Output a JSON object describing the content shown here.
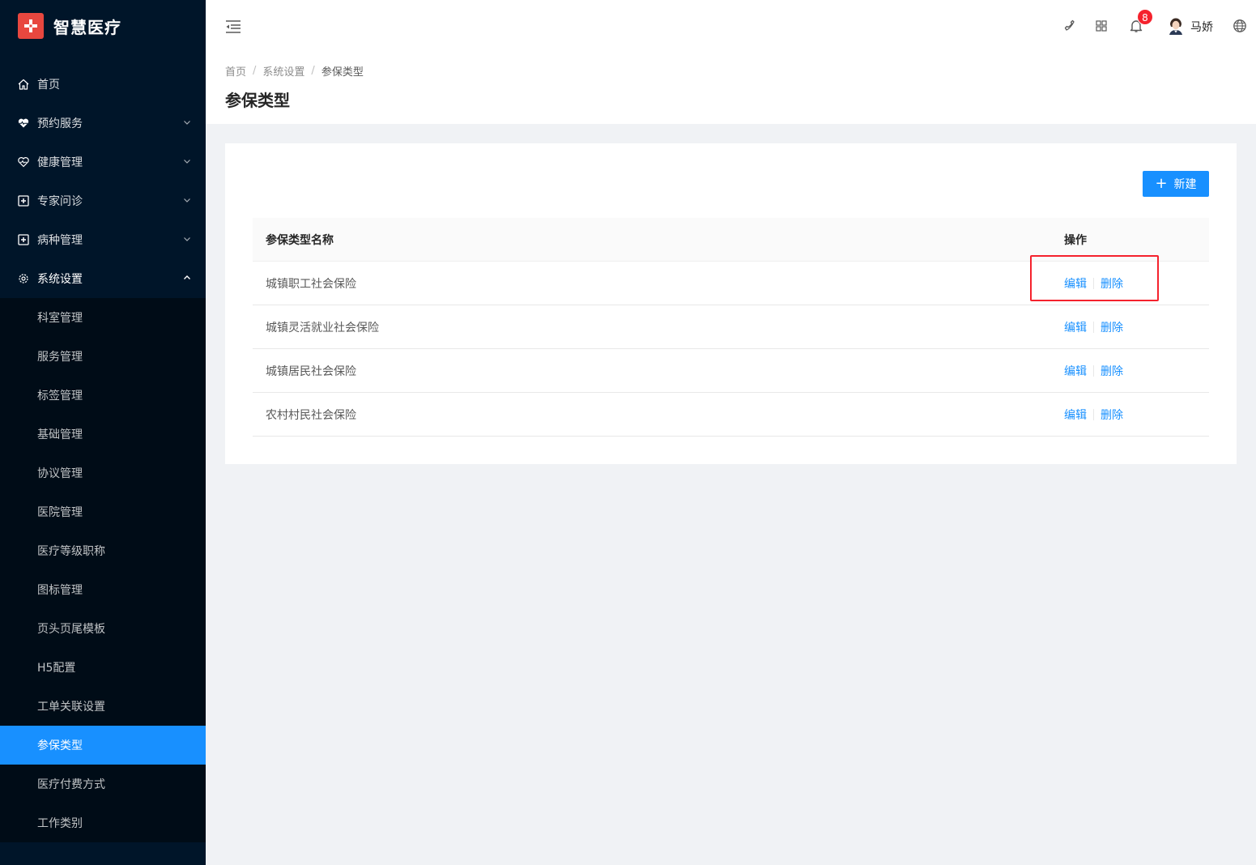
{
  "app": {
    "title": "智慧医疗"
  },
  "sidebar": {
    "items": [
      {
        "label": "首页",
        "icon": "home-icon"
      },
      {
        "label": "预约服务",
        "icon": "heart-pulse-icon"
      },
      {
        "label": "健康管理",
        "icon": "heart-outline-icon"
      },
      {
        "label": "专家问诊",
        "icon": "medical-box-icon"
      },
      {
        "label": "病种管理",
        "icon": "medical-box-icon"
      },
      {
        "label": "系统设置",
        "icon": "gear-icon"
      }
    ],
    "sub_items": [
      {
        "label": "科室管理"
      },
      {
        "label": "服务管理"
      },
      {
        "label": "标签管理"
      },
      {
        "label": "基础管理"
      },
      {
        "label": "协议管理"
      },
      {
        "label": "医院管理"
      },
      {
        "label": "医疗等级职称"
      },
      {
        "label": "图标管理"
      },
      {
        "label": "页头页尾模板"
      },
      {
        "label": "H5配置"
      },
      {
        "label": "工单关联设置"
      },
      {
        "label": "参保类型"
      },
      {
        "label": "医疗付费方式"
      },
      {
        "label": "工作类别"
      }
    ],
    "active_sub_item": "参保类型"
  },
  "header": {
    "notification_count": "8",
    "username": "马娇"
  },
  "breadcrumb": {
    "items": [
      "首页",
      "系统设置",
      "参保类型"
    ],
    "separator": "/"
  },
  "page": {
    "title": "参保类型"
  },
  "toolbar": {
    "new_label": "新建"
  },
  "table": {
    "columns": [
      "参保类型名称",
      "操作"
    ],
    "rows": [
      {
        "name": "城镇职工社会保险",
        "edit": "编辑",
        "delete": "删除"
      },
      {
        "name": "城镇灵活就业社会保险",
        "edit": "编辑",
        "delete": "删除"
      },
      {
        "name": "城镇居民社会保险",
        "edit": "编辑",
        "delete": "删除"
      },
      {
        "name": "农村村民社会保险",
        "edit": "编辑",
        "delete": "删除"
      }
    ]
  },
  "colors": {
    "sidebar_bg": "#001529",
    "submenu_bg": "#000c17",
    "primary": "#1890ff",
    "highlight": "#f5222d",
    "logo": "#e8473f"
  }
}
